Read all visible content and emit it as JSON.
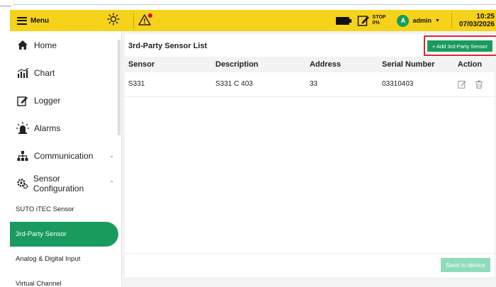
{
  "topbar": {
    "menu_label": "Menu",
    "stop_line1": "STOP",
    "stop_line2": "0%",
    "user_initial": "A",
    "user_name": "admin",
    "time": "10:25",
    "date": "07/03/2026",
    "icons": [
      "hamburger-icon",
      "sun-icon",
      "warning-icon",
      "battery-icon",
      "edit-icon",
      "chevron-down-icon"
    ]
  },
  "sidebar": {
    "items": [
      {
        "label": "Home",
        "icon": "home-icon"
      },
      {
        "label": "Chart",
        "icon": "chart-icon"
      },
      {
        "label": "Logger",
        "icon": "logger-icon"
      },
      {
        "label": "Alarms",
        "icon": "alarm-icon"
      },
      {
        "label": "Communication",
        "icon": "network-icon"
      },
      {
        "label": "Sensor Configuration",
        "icon": "gear-icon"
      }
    ],
    "sub_items": [
      {
        "label": "SUTO iTEC Sensor",
        "active": false
      },
      {
        "label": "3rd-Party Sensor",
        "active": true
      },
      {
        "label": "Analog & Digital Input",
        "active": false
      },
      {
        "label": "Virtual Channel",
        "active": false
      }
    ]
  },
  "main": {
    "title": "3rd-Party Sensor List",
    "add_button": "+ Add 3rd-Party Sensor",
    "columns": [
      "Sensor",
      "Description",
      "Address",
      "Serial Number",
      "Action"
    ],
    "rows": [
      {
        "sensor": "S331",
        "description": "S331 C 403",
        "address": "33",
        "serial": "03310403"
      }
    ],
    "save_button": "Save to device"
  },
  "colors": {
    "topbar": "#f7d21a",
    "accent": "#1a9b5e",
    "highlight": "#e0262b",
    "save_disabled": "#8fdcbc"
  }
}
